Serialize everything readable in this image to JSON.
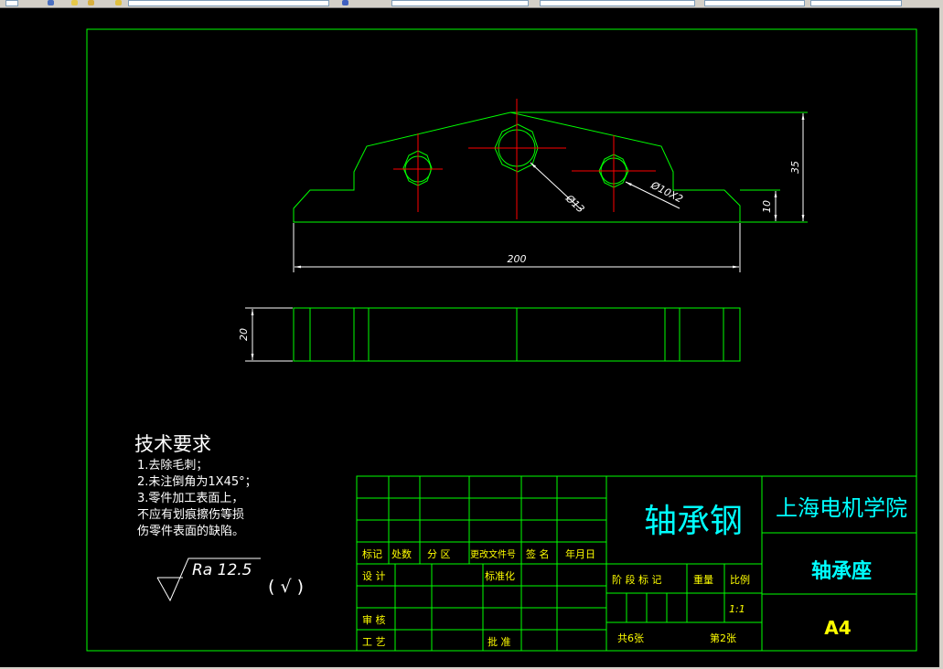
{
  "colors": {
    "background": "#000000",
    "geometry": "#00ff00",
    "dimension": "#ffffff",
    "centerline": "#ff0000",
    "title_text": "#00ffff",
    "table_text": "#ffff00"
  },
  "drawing": {
    "dims": {
      "width": "200",
      "height_total": "35",
      "height_base": "10",
      "hole_center": "Ø13",
      "hole_side": "Ø10X2",
      "thickness": "20"
    },
    "tech": {
      "title": "技术要求",
      "items": [
        "1.去除毛刺；",
        "2.未注倒角为1X45°；",
        "3.零件加工表面上，",
        "不应有划痕擦伤等损",
        "伤零件表面的缺陷。"
      ]
    },
    "roughness": {
      "value": "Ra 12.5",
      "suffix": "( √ )"
    }
  },
  "title_block": {
    "material": "轴承钢",
    "institution": "上海电机学院",
    "part_name": "轴承座",
    "sheet_size": "A4",
    "row_labels": [
      "标记",
      "处数",
      "分 区",
      "更改文件号",
      "签 名",
      "年月日"
    ],
    "labels": {
      "design": "设 计",
      "standard": "标准化",
      "review": "审 核",
      "process": "工 艺",
      "approve": "批 准",
      "stage": "阶 段 标 记",
      "weight": "重量",
      "scale": "比例"
    },
    "scale_value": "1:1",
    "sheets_total": "共6张",
    "sheet_no": "第2张"
  }
}
